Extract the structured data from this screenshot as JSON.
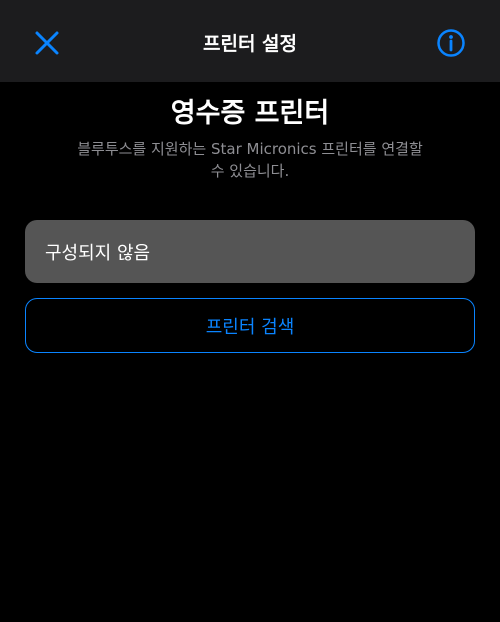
{
  "navbar": {
    "title": "프린터 설정",
    "close_icon": "close-icon",
    "info_icon": "info-icon"
  },
  "main": {
    "heading": "영수증 프린터",
    "description_line1": "블루투스를 지원하는 Star Micronics 프린터를 연결할",
    "description_line2": "수 있습니다.",
    "status_text": "구성되지 않음",
    "search_button_label": "프린터 검색"
  },
  "colors": {
    "accent": "#0a84ff",
    "background": "#000000",
    "navbar_background": "#1c1c1e",
    "status_box_background": "#555555",
    "secondary_text": "#8e8e93"
  }
}
